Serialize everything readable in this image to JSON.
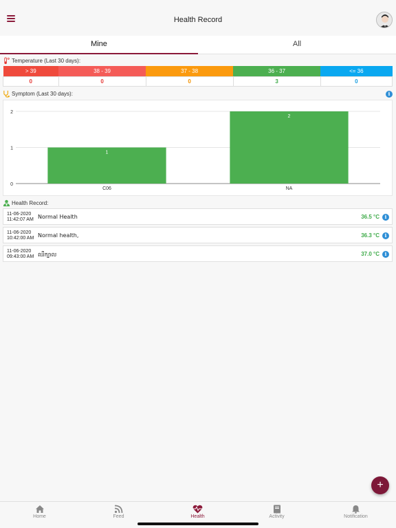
{
  "header": {
    "title": "Health Record"
  },
  "tabs": [
    {
      "label": "Mine"
    },
    {
      "label": "All"
    }
  ],
  "temperature": {
    "label": "Temperature (Last 30 days):",
    "ranges": [
      {
        "label": "> 39",
        "count": "0",
        "color": "#ef4a3c",
        "text_color": "#e53935"
      },
      {
        "label": "38 - 39",
        "count": "0",
        "color": "#f45b57",
        "text_color": "#e53935"
      },
      {
        "label": "37 - 38",
        "count": "0",
        "color": "#fb9a0e",
        "text_color": "#f39200"
      },
      {
        "label": "36 - 37",
        "count": "3",
        "color": "#4caf50",
        "text_color": "#3fab4a"
      },
      {
        "label": "<= 36",
        "count": "0",
        "color": "#0aa8f0",
        "text_color": "#1a9ee0"
      }
    ]
  },
  "symptom": {
    "label": "Symptom (Last 30 days):"
  },
  "chart_data": {
    "type": "bar",
    "categories": [
      "C06",
      "NA"
    ],
    "values": [
      1,
      2
    ],
    "data_labels": [
      "1",
      "2"
    ],
    "ylim": [
      0,
      2
    ],
    "yticks": [
      "0",
      "1",
      "2"
    ],
    "grid": true,
    "bar_color": "#4caf50"
  },
  "health_record": {
    "label": "Health Record:",
    "items": [
      {
        "date": "11-06-2020",
        "time": "11:42:07 AM",
        "note": "Normal Health",
        "temp": "36.5 °C"
      },
      {
        "date": "11-06-2020",
        "time": "10:42:00 AM",
        "note": "Normal health,",
        "temp": "36.3 °C"
      },
      {
        "date": "11-06-2020",
        "time": "09:43:00 AM",
        "note": "ឈឺក្បាល",
        "temp": "37.0 °C"
      }
    ]
  },
  "fab": {
    "label": "+"
  },
  "nav": [
    {
      "label": "Home",
      "icon": "home-icon"
    },
    {
      "label": "Feed",
      "icon": "rss-icon"
    },
    {
      "label": "Health",
      "icon": "heartbeat-icon"
    },
    {
      "label": "Activity",
      "icon": "book-icon"
    },
    {
      "label": "Notification",
      "icon": "bell-icon"
    }
  ],
  "colors": {
    "accent": "#8b1a3a",
    "info": "#2f8fd6",
    "green": "#3fab4a"
  }
}
